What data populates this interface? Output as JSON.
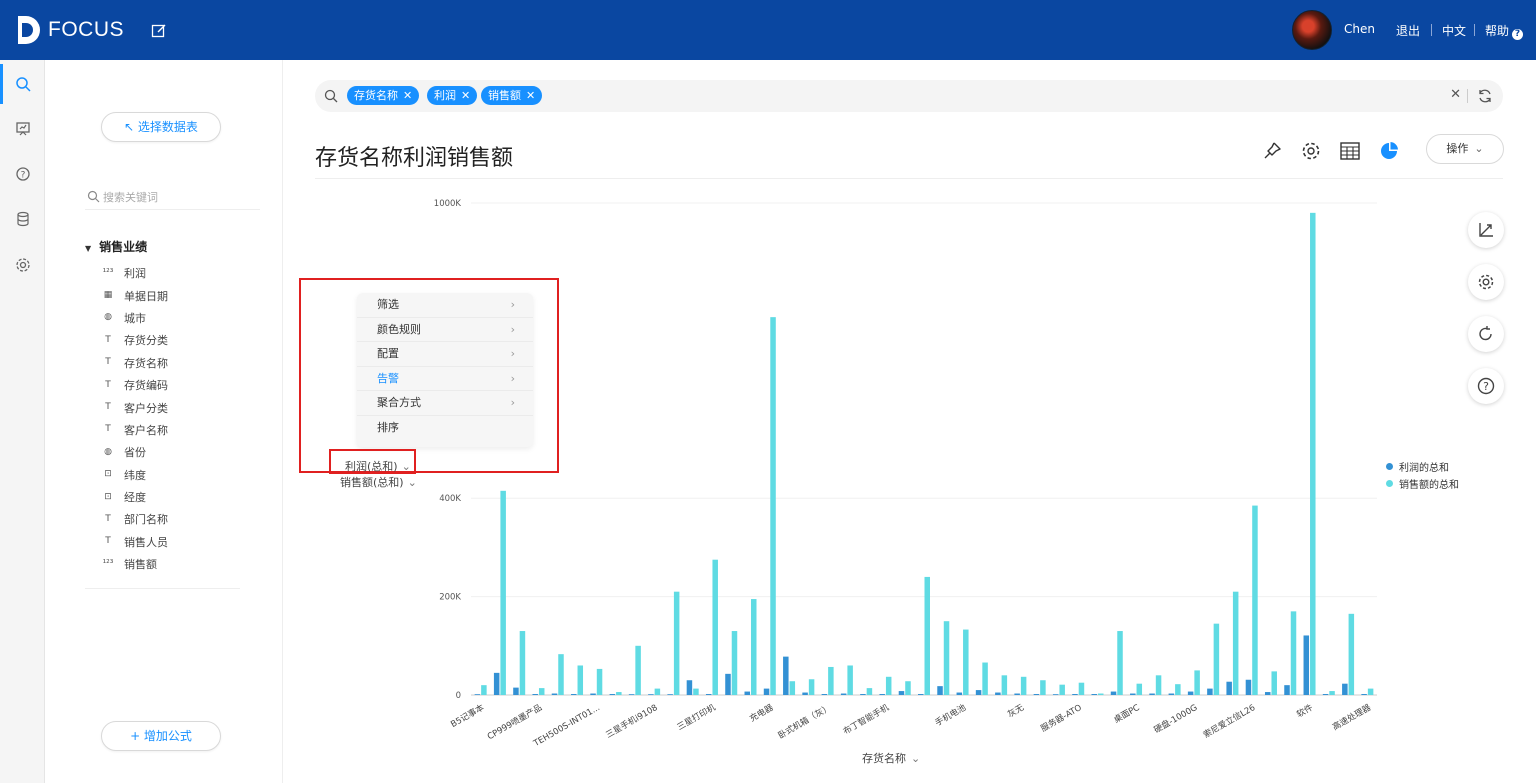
{
  "app": {
    "brand": "FOCUS"
  },
  "header": {
    "user": "Chen",
    "logout": "退出",
    "language": "中文",
    "help": "帮助"
  },
  "rail": {
    "icons": [
      "search-icon",
      "dashboard-icon",
      "question-icon",
      "database-icon",
      "gear-icon"
    ]
  },
  "panel": {
    "select_table": "↖ 选择数据表",
    "search_placeholder": "搜索关键词",
    "group": "销售业绩",
    "fields": [
      {
        "label": "利润",
        "type": "123"
      },
      {
        "label": "单据日期",
        "type": "date"
      },
      {
        "label": "城市",
        "type": "geo"
      },
      {
        "label": "存货分类",
        "type": "text"
      },
      {
        "label": "存货名称",
        "type": "text"
      },
      {
        "label": "存货编码",
        "type": "text"
      },
      {
        "label": "客户分类",
        "type": "text"
      },
      {
        "label": "客户名称",
        "type": "text"
      },
      {
        "label": "省份",
        "type": "geo"
      },
      {
        "label": "纬度",
        "type": "coord"
      },
      {
        "label": "经度",
        "type": "coord"
      },
      {
        "label": "部门名称",
        "type": "text"
      },
      {
        "label": "销售人员",
        "type": "text"
      },
      {
        "label": "销售额",
        "type": "123"
      }
    ],
    "add_formula": "+ 增加公式"
  },
  "query": {
    "tags": [
      "存货名称",
      "利润",
      "销售额"
    ]
  },
  "page": {
    "title": "存货名称利润销售额",
    "ops_button": "操作"
  },
  "context_menu": {
    "items": [
      {
        "label": "筛选",
        "has_submenu": true,
        "active": false
      },
      {
        "label": "颜色规则",
        "has_submenu": true,
        "active": false
      },
      {
        "label": "配置",
        "has_submenu": true,
        "active": false
      },
      {
        "label": "告警",
        "has_submenu": true,
        "active": true
      },
      {
        "label": "聚合方式",
        "has_submenu": true,
        "active": false
      },
      {
        "label": "排序",
        "has_submenu": false,
        "active": false
      }
    ]
  },
  "measures": {
    "profit": "利润(总和)",
    "sales": "销售额(总和)"
  },
  "colors": {
    "header": "#0a47a1",
    "accent": "#1890ff",
    "profit": "#3391d4",
    "sales": "#5fdbe3",
    "highlight": "#e02020"
  },
  "chart_data": {
    "type": "bar",
    "xlabel": "存货名称",
    "ylabel": "",
    "ylim": [
      0,
      1000000
    ],
    "yticks": [
      {
        "value": 0,
        "label": "0"
      },
      {
        "value": 200000,
        "label": "200K"
      },
      {
        "value": 400000,
        "label": "400K"
      },
      {
        "value": 1000000,
        "label": "1000K"
      }
    ],
    "x_tick_labels": [
      "B5记事本",
      "CP999喷墨产品",
      "TEH500S-INT01...",
      "三星手机i9108",
      "三星打印机",
      "充电器",
      "卧式机箱（灰）",
      "布丁智能手机",
      "手机电池",
      "灰无",
      "服务器-ATO",
      "桌面PC",
      "硬盘-1000G",
      "索尼爱立信L26",
      "软件",
      "高速处理器"
    ],
    "series": [
      {
        "name": "利润的总和",
        "values": [
          1500,
          45000,
          15000,
          2000,
          3000,
          2000,
          3000,
          2000,
          1500,
          1000,
          1500,
          30000,
          2000,
          43000,
          7000,
          13000,
          78000,
          5000,
          2000,
          3000,
          2000,
          2000,
          8000,
          2000,
          18000,
          5000,
          10000,
          5000,
          3000,
          2000,
          1500,
          2000,
          2000,
          7000,
          3000,
          3000,
          3000,
          7000,
          13000,
          27000,
          31000,
          6000,
          20000,
          121000,
          2000,
          23000,
          2000
        ]
      },
      {
        "name": "销售额的总和",
        "values": [
          20000,
          415000,
          130000,
          14000,
          83000,
          60000,
          53000,
          6000,
          100000,
          13000,
          210000,
          13000,
          275000,
          130000,
          195000,
          768000,
          28000,
          32000,
          57000,
          60000,
          14000,
          37000,
          28000,
          240000,
          150000,
          133000,
          66000,
          40000,
          37000,
          30000,
          21000,
          25000,
          3000,
          130000,
          23000,
          40000,
          22000,
          50000,
          145000,
          210000,
          385000,
          48000,
          170000,
          980000,
          8000,
          165000,
          13000
        ]
      }
    ],
    "legend_position": "right",
    "grid": true
  }
}
